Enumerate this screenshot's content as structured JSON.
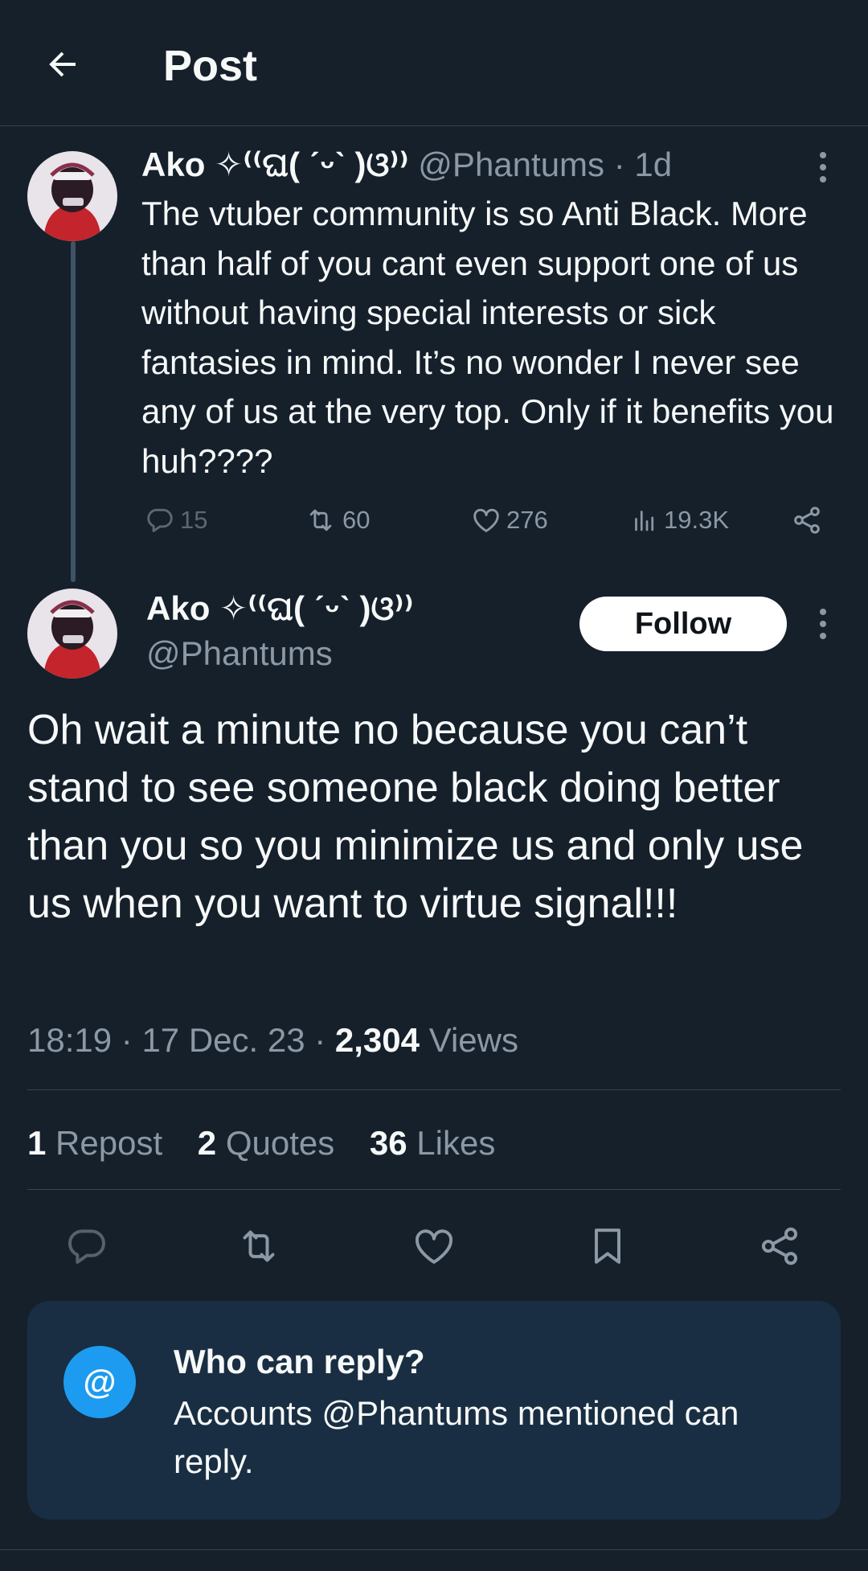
{
  "header": {
    "title": "Post"
  },
  "parent_post": {
    "display_name": "Ako ✧⁽⁽ଘ( ˊᵕˋ )ଓ⁾⁾",
    "handle": "@Phantums",
    "separator": "·",
    "time": "1d",
    "text": "The vtuber community is so Anti Black. More than half of you cant even support one of us without having special interests or sick fantasies in mind. It’s no wonder I never see any of us at the very top. Only if it benefits you huh????",
    "replies": "15",
    "reposts": "60",
    "likes": "276",
    "views": "19.3K"
  },
  "main_post": {
    "display_name": "Ako ✧⁽⁽ଘ( ˊᵕˋ )ଓ⁾⁾",
    "handle": "@Phantums",
    "follow_label": "Follow",
    "text": "Oh wait a minute no because you can’t stand to see someone black doing better than you so you minimize us and only use us when you want to virtue signal!!!",
    "time": "18:19",
    "date": "17 Dec. 23",
    "view_count": "2,304",
    "views_label": "Views",
    "reposts_count": "1",
    "reposts_label": "Repost",
    "quotes_count": "2",
    "quotes_label": "Quotes",
    "likes_count": "36",
    "likes_label": "Likes"
  },
  "reply_settings": {
    "icon_glyph": "@",
    "title": "Who can reply?",
    "description": "Accounts @Phantums mentioned can reply."
  },
  "icons": [
    "back-arrow-icon",
    "more-icon",
    "reply-icon",
    "repost-icon",
    "like-icon",
    "views-icon",
    "share-icon",
    "bookmark-icon",
    "at-icon"
  ],
  "colors": {
    "background": "#15202b",
    "text": "#f7f9f9",
    "muted": "#8b98a5",
    "accent": "#1d9bf0",
    "card": "#192e42"
  }
}
